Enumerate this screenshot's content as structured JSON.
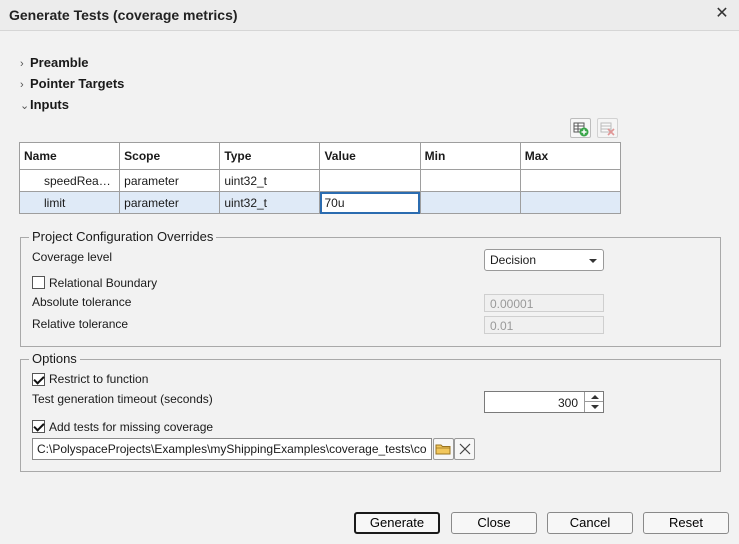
{
  "window": {
    "title": "Generate Tests (coverage metrics)",
    "close_glyph": "✕"
  },
  "sections": {
    "preamble": {
      "label": "Preamble",
      "expanded": false
    },
    "pointer_targets": {
      "label": "Pointer Targets",
      "expanded": false
    },
    "inputs": {
      "label": "Inputs",
      "expanded": true
    }
  },
  "toolbar": {
    "add_icon": "add-row-icon",
    "remove_icon": "remove-row-icon"
  },
  "inputs_table": {
    "columns": [
      "Name",
      "Scope",
      "Type",
      "Value",
      "Min",
      "Max"
    ],
    "rows": [
      {
        "name": "speedReadi...",
        "scope": "parameter",
        "type": "uint32_t",
        "value": "",
        "min": "",
        "max": ""
      },
      {
        "name": "limit",
        "scope": "parameter",
        "type": "uint32_t",
        "value": "70u",
        "min": "",
        "max": ""
      }
    ]
  },
  "config": {
    "legend": "Project Configuration Overrides",
    "coverage_level_label": "Coverage level",
    "coverage_level_value": "Decision",
    "relational_boundary_label": "Relational Boundary",
    "relational_boundary_checked": false,
    "absolute_tolerance_label": "Absolute tolerance",
    "absolute_tolerance_value": "0.00001",
    "relative_tolerance_label": "Relative tolerance",
    "relative_tolerance_value": "0.01"
  },
  "options": {
    "legend": "Options",
    "restrict_label": "Restrict to function",
    "restrict_checked": true,
    "timeout_label": "Test generation timeout (seconds)",
    "timeout_value": "300",
    "add_tests_label": "Add tests for missing coverage",
    "add_tests_checked": true,
    "path_value": "C:\\PolyspaceProjects\\Examples\\myShippingExamples\\coverage_tests\\co"
  },
  "buttons": {
    "generate": "Generate",
    "close": "Close",
    "cancel": "Cancel",
    "reset": "Reset"
  },
  "colors": {
    "selected_row": "#dfeaf7",
    "accent": "#2b6cb0",
    "background": "#f2f2f2"
  }
}
